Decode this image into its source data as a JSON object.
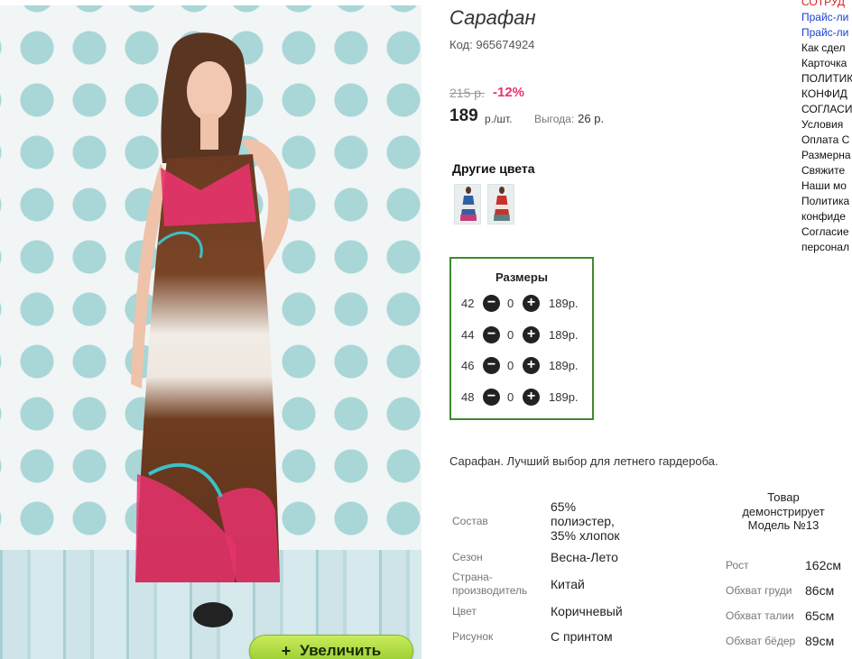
{
  "product": {
    "title": "Сарафан",
    "code_label": "Код:",
    "code": "965674924",
    "old_price": "215 р.",
    "discount": "-12%",
    "price": "189",
    "price_unit": "р./шт.",
    "savings_label": "Выгода:",
    "savings": "26 р."
  },
  "zoom_button": {
    "plus": "+",
    "label": "Увеличить"
  },
  "other_colors": {
    "heading": "Другие цвета",
    "thumbnails": [
      "blue-dress-thumbnail",
      "red-dress-thumbnail"
    ]
  },
  "sizes": {
    "heading": "Размеры",
    "minus": "−",
    "plus": "+",
    "rows": [
      {
        "size": "42",
        "qty": "0",
        "price": "189р."
      },
      {
        "size": "44",
        "qty": "0",
        "price": "189р."
      },
      {
        "size": "46",
        "qty": "0",
        "price": "189р."
      },
      {
        "size": "48",
        "qty": "0",
        "price": "189р."
      }
    ]
  },
  "description": "Сарафан. Лучший выбор для летнего гардероба.",
  "specs": {
    "composition_label": "Состав",
    "composition": [
      "65%",
      "полиэстер,",
      "35% хлопок"
    ],
    "season_label": "Сезон",
    "season": "Весна-Лето",
    "country_label": [
      "Страна-",
      "производитель"
    ],
    "country": "Китай",
    "color_label": "Цвет",
    "color": "Коричневый",
    "pattern_label": "Рисунок",
    "pattern": "С принтом"
  },
  "model": {
    "heading": [
      "Товар",
      "демонстрирует",
      "Модель №13"
    ],
    "rows": [
      {
        "label": "Рост",
        "value": "162см"
      },
      {
        "label": "Обхват груди",
        "value": "86см"
      },
      {
        "label": "Обхват талии",
        "value": "65см"
      },
      {
        "label": "Обхват бёдер",
        "value": "89см"
      }
    ]
  },
  "right_links": [
    {
      "text": "СОТРУД",
      "style": "red"
    },
    {
      "text": "Прайс-ли",
      "style": "blue"
    },
    {
      "text": "Прайс-ли",
      "style": "blue"
    },
    {
      "text": "Как сдел",
      "style": "plain"
    },
    {
      "text": "Карточка",
      "style": "plain"
    },
    {
      "text": "ПОЛИТИК",
      "style": "plain"
    },
    {
      "text": "КОНФИД",
      "style": "plain"
    },
    {
      "text": "СОГЛАСИ",
      "style": "plain"
    },
    {
      "text": "Условия",
      "style": "plain"
    },
    {
      "text": "Оплата С",
      "style": "plain"
    },
    {
      "text": "Размерна",
      "style": "plain"
    },
    {
      "text": "Свяжите",
      "style": "plain"
    },
    {
      "text": "Наши мо",
      "style": "plain"
    },
    {
      "text": "Политика",
      "style": "plain"
    },
    {
      "text": "конфиде",
      "style": "plain"
    },
    {
      "text": "Согласие",
      "style": "plain"
    },
    {
      "text": "персонал",
      "style": "plain"
    }
  ],
  "colors": {
    "accent_pink": "#e8336d",
    "sizes_border": "#3d8b2e",
    "zoom_green": "#a6d73b",
    "link_blue": "#1a3fd1"
  }
}
